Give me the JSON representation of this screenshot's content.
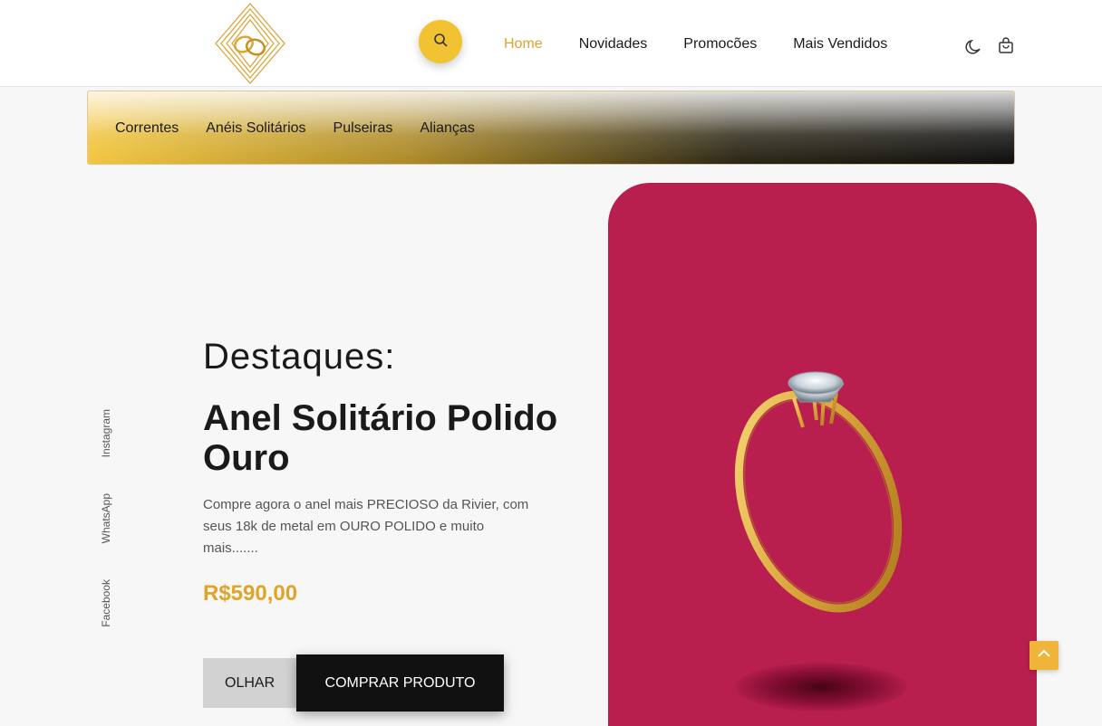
{
  "brand": {
    "logo_icon": "wedding-rings-logo",
    "accent": "#e0a426",
    "search_bg": "#f1c232"
  },
  "header": {
    "nav": [
      {
        "label": "Home",
        "active": true
      },
      {
        "label": "Novidades"
      },
      {
        "label": "Promocões"
      },
      {
        "label": "Mais Vendidos"
      }
    ],
    "icons": [
      "search-icon",
      "moon-icon",
      "shopping-bag-icon"
    ]
  },
  "categories": [
    "Correntes",
    "Anéis Solitários",
    "Pulseiras",
    "Alianças"
  ],
  "social": [
    "Instagram",
    "WhatsApp",
    "Facebook"
  ],
  "highlight": {
    "section_title": "Destaques:",
    "product_title": "Anel Solitário Polido Ouro",
    "description": "Compre agora o anel mais PRECIOSO da Rivier, com seus 18k de metal em OURO POLIDO e muito mais.......",
    "price": "R$590,00",
    "btn_view": "OLHAR",
    "btn_buy": "COMPRAR PRODUTO",
    "card_color": "#b81f4e"
  }
}
